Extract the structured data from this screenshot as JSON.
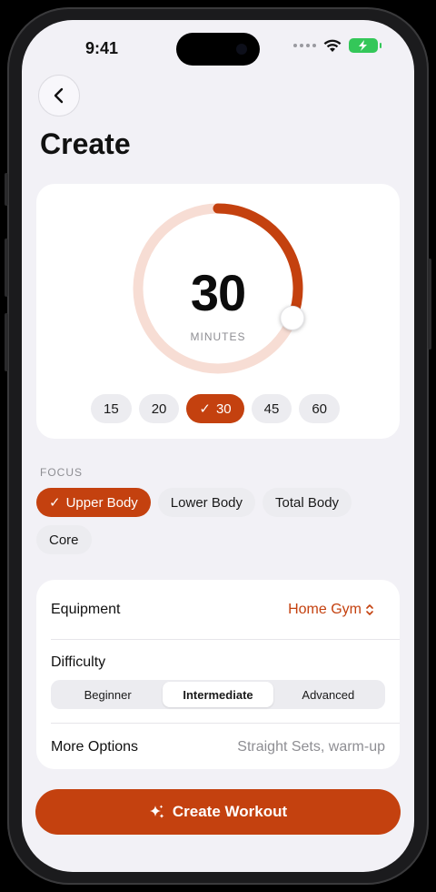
{
  "status": {
    "time": "9:41"
  },
  "header": {
    "title": "Create",
    "back_icon": "chevron-left-icon"
  },
  "duration": {
    "value": "30",
    "unit": "MINUTES",
    "max_minutes": 60,
    "ring_fraction": 0.31,
    "options": [
      "15",
      "20",
      "30",
      "45",
      "60"
    ],
    "selected": "30"
  },
  "focus": {
    "label": "FOCUS",
    "options": [
      "Upper Body",
      "Lower Body",
      "Total Body",
      "Core"
    ],
    "selected": "Upper Body"
  },
  "settings": {
    "equipment_label": "Equipment",
    "equipment_value": "Home Gym",
    "difficulty_label": "Difficulty",
    "difficulty_options": [
      "Beginner",
      "Intermediate",
      "Advanced"
    ],
    "difficulty_selected": "Intermediate",
    "more_label": "More Options",
    "more_value": "Straight Sets, warm-up"
  },
  "action": {
    "create_label": "Create Workout",
    "icon": "sparkle-icon"
  },
  "colors": {
    "accent": "#C4410F",
    "ring_track": "#F7DDD4",
    "background": "#F2F1F6"
  }
}
